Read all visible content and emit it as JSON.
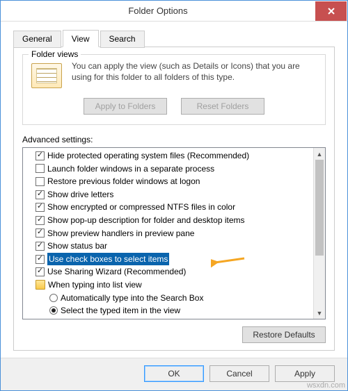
{
  "window": {
    "title": "Folder Options"
  },
  "tabs": {
    "general": "General",
    "view": "View",
    "search": "Search"
  },
  "folder_views": {
    "legend": "Folder views",
    "text": "You can apply the view (such as Details or Icons) that you are using for this folder to all folders of this type.",
    "apply_label": "Apply to Folders",
    "reset_label": "Reset Folders"
  },
  "advanced": {
    "label": "Advanced settings:",
    "items": [
      {
        "type": "check",
        "checked": true,
        "label": "Hide protected operating system files (Recommended)"
      },
      {
        "type": "check",
        "checked": false,
        "label": "Launch folder windows in a separate process"
      },
      {
        "type": "check",
        "checked": false,
        "label": "Restore previous folder windows at logon"
      },
      {
        "type": "check",
        "checked": true,
        "label": "Show drive letters"
      },
      {
        "type": "check",
        "checked": true,
        "label": "Show encrypted or compressed NTFS files in color"
      },
      {
        "type": "check",
        "checked": true,
        "label": "Show pop-up description for folder and desktop items"
      },
      {
        "type": "check",
        "checked": true,
        "label": "Show preview handlers in preview pane"
      },
      {
        "type": "check",
        "checked": true,
        "label": "Show status bar"
      },
      {
        "type": "check",
        "checked": true,
        "label": "Use check boxes to select items",
        "highlighted": true
      },
      {
        "type": "check",
        "checked": true,
        "label": "Use Sharing Wizard (Recommended)"
      },
      {
        "type": "group",
        "label": "When typing into list view"
      },
      {
        "type": "radio",
        "checked": false,
        "label": "Automatically type into the Search Box",
        "indent": true
      },
      {
        "type": "radio",
        "checked": true,
        "label": "Select the typed item in the view",
        "indent": true
      }
    ]
  },
  "buttons": {
    "restore_defaults": "Restore Defaults",
    "ok": "OK",
    "cancel": "Cancel",
    "apply": "Apply"
  },
  "watermark": "wsxdn.com"
}
